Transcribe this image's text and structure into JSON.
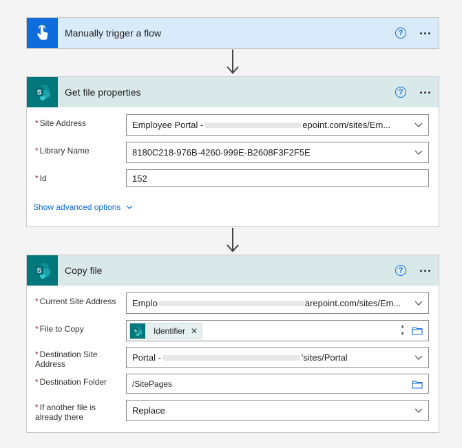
{
  "colors": {
    "trigger_accent": "#0f6cdd",
    "sharepoint_accent": "#03787c",
    "trigger_header_bg": "#d9ebfb",
    "sp_header_bg": "#d9e8e8",
    "required": "#a4262c"
  },
  "trigger": {
    "title": "Manually trigger a flow",
    "icon": "touch-hand-icon"
  },
  "get_props": {
    "title": "Get file properties",
    "icon": "sharepoint-icon",
    "fields": [
      {
        "label": "Site Address",
        "value_prefix": "Employee Portal - ",
        "value_suffix": "epoint.com/sites/Em...",
        "type": "dropdown"
      },
      {
        "label": "Library Name",
        "value": "8180C218-976B-4260-999E-B2608F3F2F5E",
        "type": "dropdown"
      },
      {
        "label": "Id",
        "value": "152",
        "type": "text"
      }
    ],
    "advanced_label": "Show advanced options"
  },
  "copy_file": {
    "title": "Copy file",
    "icon": "sharepoint-icon",
    "fields": [
      {
        "label": "Current Site Address",
        "value_prefix": "Emplo",
        "value_suffix": "arepoint.com/sites/Em...",
        "type": "dropdown"
      },
      {
        "label": "File to Copy",
        "token": "Identifier",
        "type": "token"
      },
      {
        "label": "Destination Site Address",
        "value_prefix": "Portal - ",
        "value_suffix": "'sites/Portal",
        "type": "dropdown"
      },
      {
        "label": "Destination Folder",
        "value": "/SitePages",
        "type": "folder"
      },
      {
        "label": "If another file is already there",
        "value": "Replace",
        "type": "dropdown"
      }
    ]
  },
  "header_actions": {
    "help": "?",
    "more": "more-options-icon"
  }
}
